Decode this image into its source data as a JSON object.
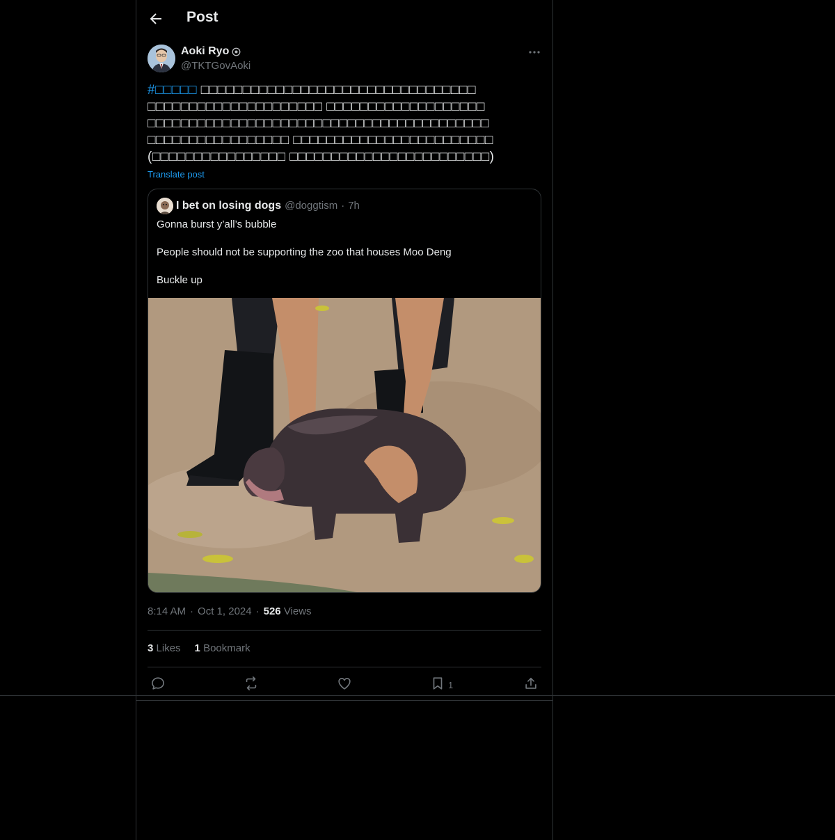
{
  "header": {
    "title": "Post"
  },
  "post": {
    "author_name": "Aoki Ryo",
    "author_handle": "@TKTGovAoki",
    "hashtag": "#□□□□□",
    "text_lines": [
      "□□□□□□□□□□□□□□□□□□□□□□□□□□□□□□□□□",
      "□□□□□□□□□□□□□□□□□□□□□ □□□□□□□□□□□□□□□□□□□",
      "□□□□□□□□□□□□□□□□□□□□□□□□□□□□□□□□□□□□□□□□□",
      "□□□□□□□□□□□□□□□□□ □□□□□□□□□□□□□□□□□□□□□□□□",
      "(□□□□□□□□□□□□□□□□ □□□□□□□□□□□□□□□□□□□□□□□□)"
    ],
    "translate_label": "Translate post",
    "time": "8:14 AM",
    "date": "Oct 1, 2024",
    "views_count": "526",
    "views_label": "Views",
    "likes_count": "3",
    "likes_label": "Likes",
    "bookmarks_count": "1",
    "bookmarks_label": "Bookmark",
    "bookmark_action_count": "1",
    "separator": "·"
  },
  "quote": {
    "name": "I bet on losing dogs",
    "handle": "@doggtism",
    "age": "7h",
    "lines": [
      "Gonna burst y’all’s bubble",
      "People should not be supporting the zoo that houses Moo Deng",
      "Buckle up"
    ]
  },
  "colors": {
    "background": "#000000",
    "text": "#e7e9ea",
    "muted": "#71767b",
    "accent": "#1d9bf0",
    "border": "#2f3336"
  },
  "icons": {
    "back": "arrow-left-icon",
    "more": "more-dots-icon",
    "reply": "reply-icon",
    "repost": "repost-icon",
    "like": "heart-icon",
    "bookmark": "bookmark-icon",
    "share": "share-icon"
  }
}
